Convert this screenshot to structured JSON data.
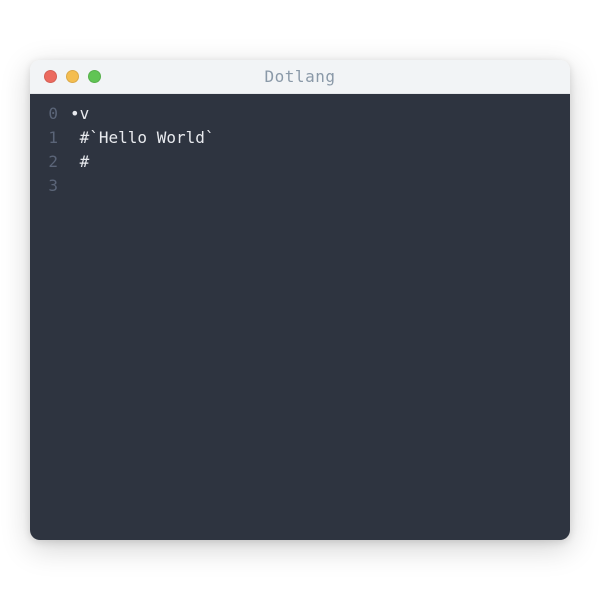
{
  "window": {
    "title": "Dotlang"
  },
  "gutter": {
    "lines": [
      "0",
      "1",
      "2",
      "3"
    ]
  },
  "code": {
    "lines": [
      "•v",
      " #`Hello World`",
      " #",
      ""
    ]
  }
}
